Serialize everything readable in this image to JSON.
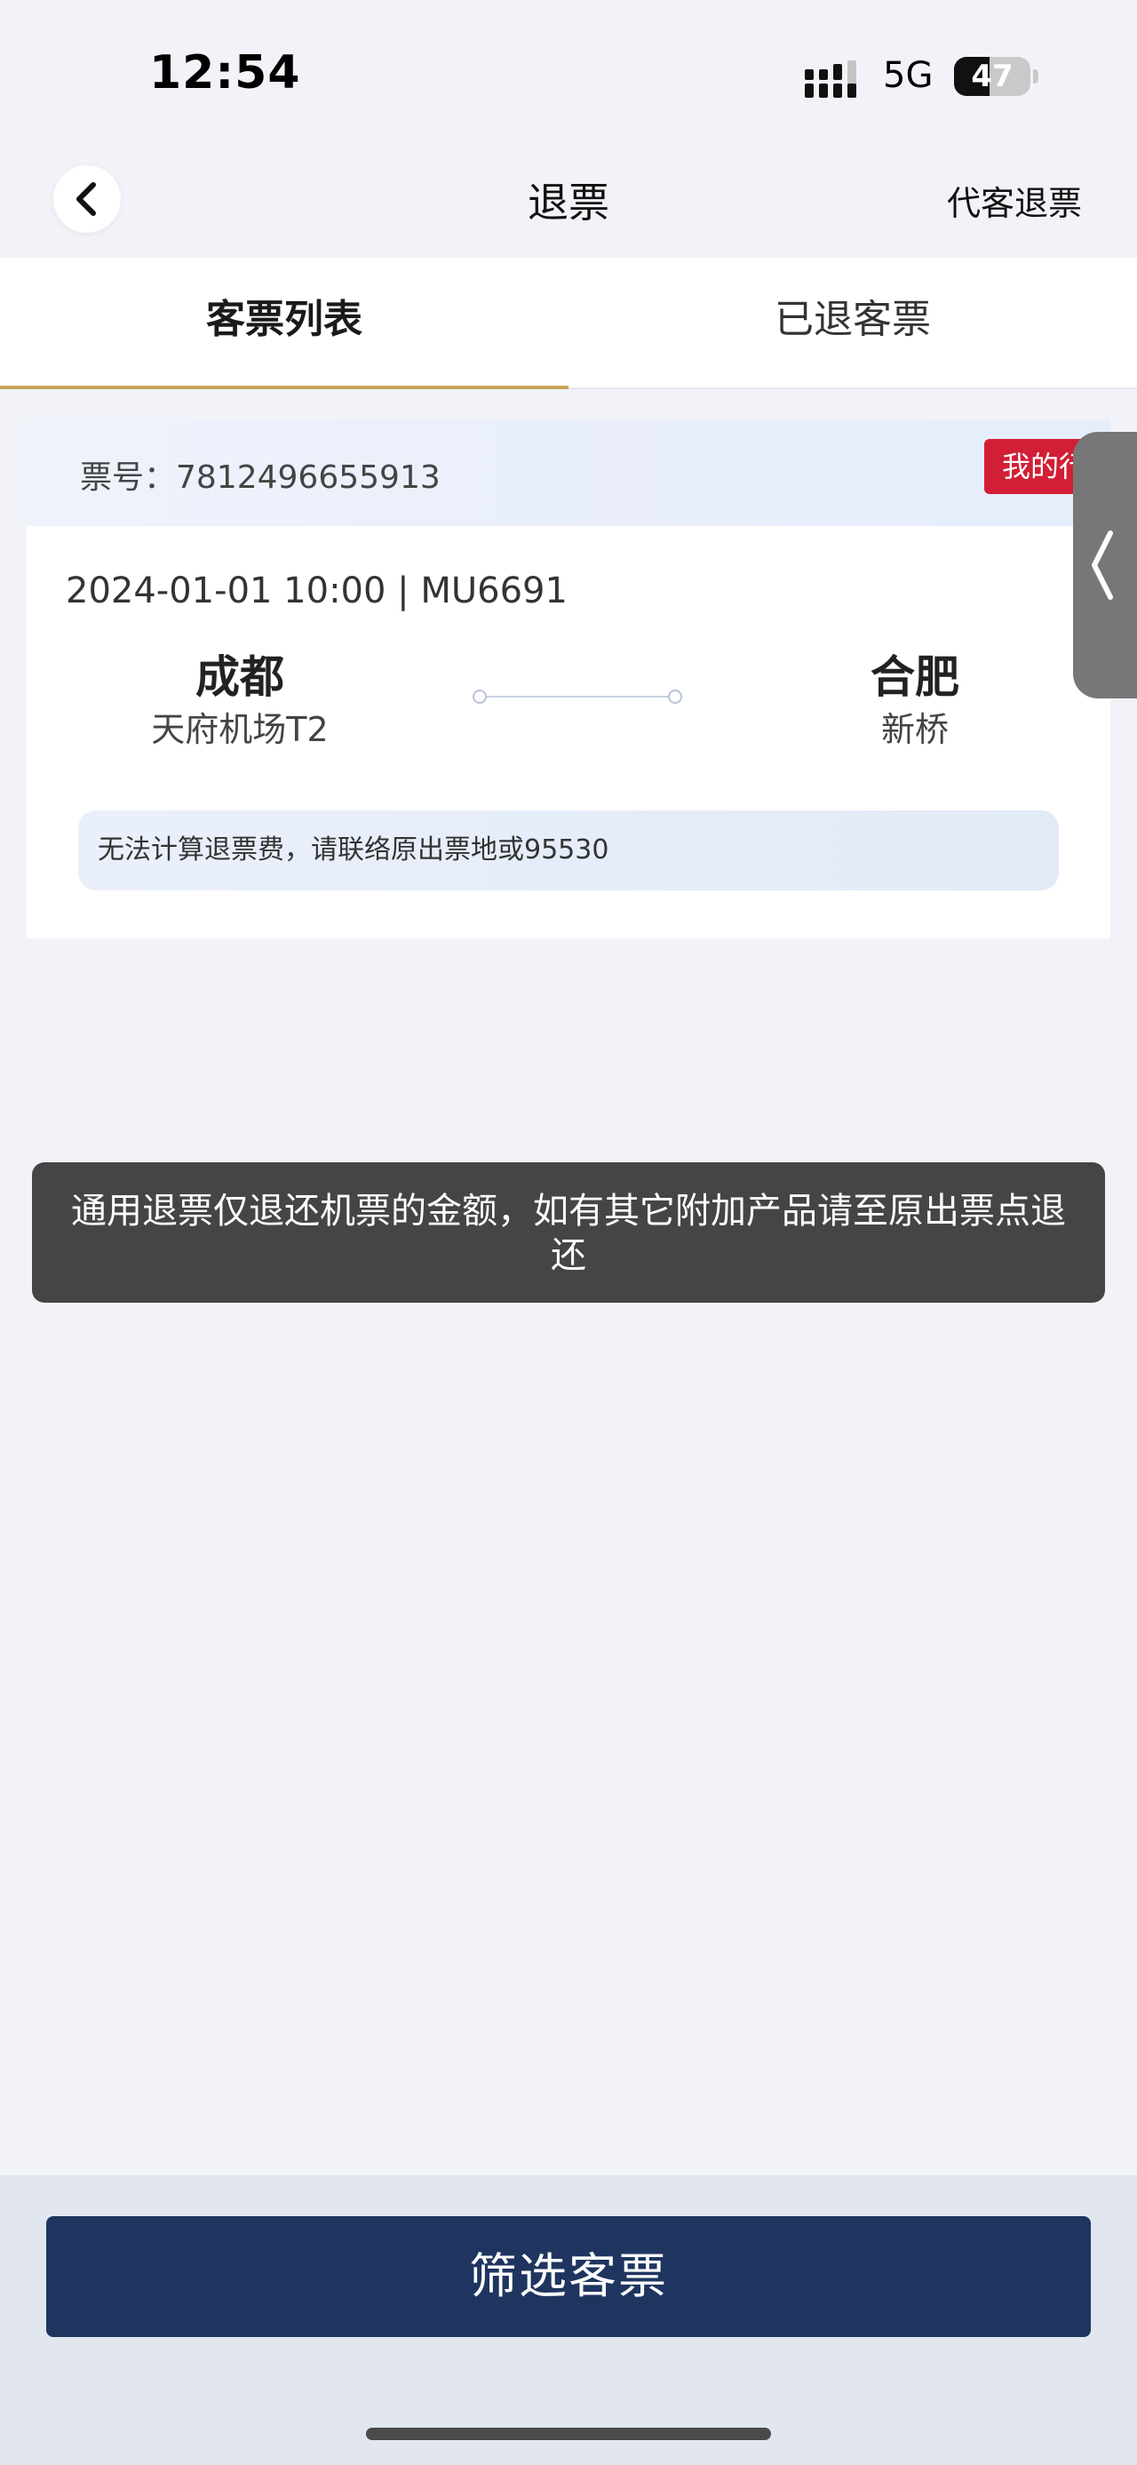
{
  "status_bar": {
    "time": "12:54",
    "network": "5G",
    "battery": "47",
    "battery_level": 0.47,
    "icons": {
      "signal": "signal-bars-icon"
    }
  },
  "nav": {
    "title": "退票",
    "right_action": "代客退票",
    "icons": {
      "back": "chevron-left-icon"
    }
  },
  "tabs": [
    {
      "label": "客票列表",
      "active": true
    },
    {
      "label": "已退客票",
      "active": false
    }
  ],
  "ticket": {
    "number_label": "票号：7812496655913",
    "badge": "我的行",
    "flight": "2024-01-01 10:00 | MU6691",
    "departure": {
      "city": "成都",
      "airport": "天府机场T2"
    },
    "arrival": {
      "city": "合肥",
      "airport": "新桥"
    },
    "notice": "无法计算退票费，请联络原出票地或95530"
  },
  "toast": {
    "message": "通用退票仅退还机票的金额，如有其它附加产品请至原出票点退还"
  },
  "bottom": {
    "button_label": "筛选客票"
  },
  "colors": {
    "accent_gold": "#c8a35a",
    "badge_red": "#d21f35",
    "primary_navy": "#1f3560",
    "toast_bg": "#454545"
  }
}
